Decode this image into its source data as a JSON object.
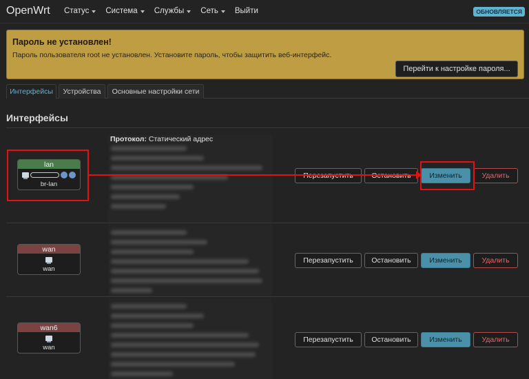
{
  "nav": {
    "brand": "OpenWrt",
    "menu": [
      {
        "label": "Статус",
        "dropdown": true
      },
      {
        "label": "Система",
        "dropdown": true
      },
      {
        "label": "Службы",
        "dropdown": true
      },
      {
        "label": "Сеть",
        "dropdown": true
      },
      {
        "label": "Выйти",
        "dropdown": false
      }
    ],
    "badge": "ОБНОВЛЯЕТСЯ"
  },
  "alert": {
    "title": "Пароль не установлен!",
    "text": "Пароль пользователя root не установлен. Установите пароль, чтобы защитить веб-интерфейс.",
    "button": "Перейти к настройке пароля..."
  },
  "tabs": [
    "Интерфейсы",
    "Устройства",
    "Основные настройки сети"
  ],
  "section_title": "Интерфейсы",
  "interfaces": [
    {
      "name": "lan",
      "device": "br-lan",
      "color": "#4a7b4a",
      "protocol_label": "Протокол:",
      "protocol_value": "Статический адрес"
    },
    {
      "name": "wan",
      "device": "wan",
      "color": "#7b4242"
    },
    {
      "name": "wan6",
      "device": "wan",
      "color": "#7b4242"
    }
  ],
  "actions": {
    "restart": "Перезапустить",
    "stop": "Остановить",
    "edit": "Изменить",
    "delete": "Удалить"
  },
  "colors": {
    "accent": "#5fb2d0",
    "alert_bg": "#bf9d42",
    "edit_button": "#4a90a8",
    "delete_text": "#e36b6b",
    "highlight": "#e3120f"
  }
}
